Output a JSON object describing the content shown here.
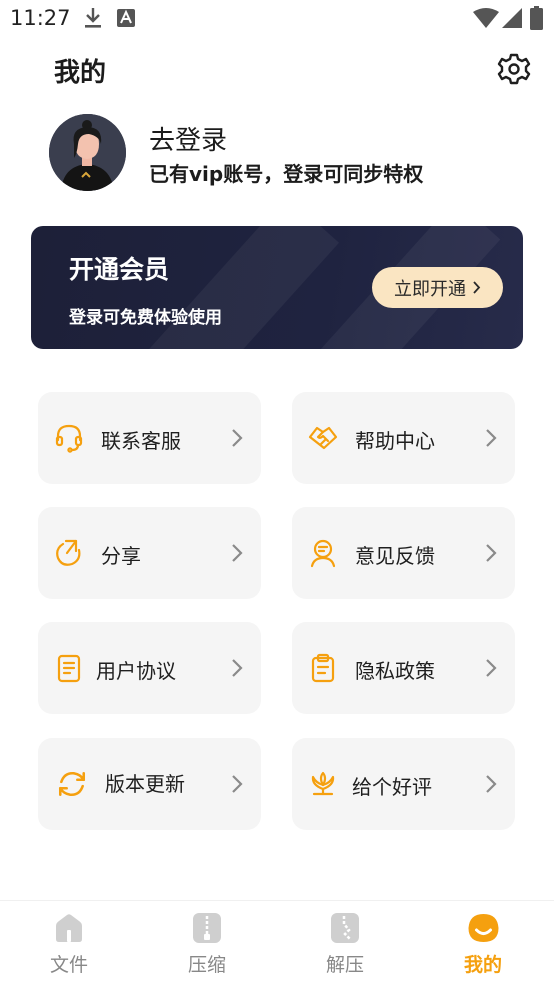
{
  "status_bar": {
    "time": "11:27"
  },
  "header": {
    "title": "我的"
  },
  "profile": {
    "title": "去登录",
    "subtitle": "已有vip账号，登录可同步特权"
  },
  "vip_banner": {
    "title": "开通会员",
    "subtitle": "登录可免费体验使用",
    "button_label": "立即开通"
  },
  "menu": [
    {
      "label": "联系客服",
      "icon": "headset-icon"
    },
    {
      "label": "帮助中心",
      "icon": "handshake-icon"
    },
    {
      "label": "分享",
      "icon": "share-icon"
    },
    {
      "label": "意见反馈",
      "icon": "feedback-icon"
    },
    {
      "label": "用户协议",
      "icon": "agreement-icon"
    },
    {
      "label": "隐私政策",
      "icon": "privacy-icon"
    },
    {
      "label": "版本更新",
      "icon": "update-icon"
    },
    {
      "label": "给个好评",
      "icon": "rate-icon"
    }
  ],
  "bottom_nav": [
    {
      "label": "文件",
      "icon": "home-icon",
      "active": false
    },
    {
      "label": "压缩",
      "icon": "compress-icon",
      "active": false
    },
    {
      "label": "解压",
      "icon": "extract-icon",
      "active": false
    },
    {
      "label": "我的",
      "icon": "profile-icon",
      "active": true
    }
  ],
  "colors": {
    "accent": "#f5a00f",
    "banner_bg": "#1f2340",
    "button_bg": "#fae5c2",
    "card_bg": "#f5f5f5"
  }
}
